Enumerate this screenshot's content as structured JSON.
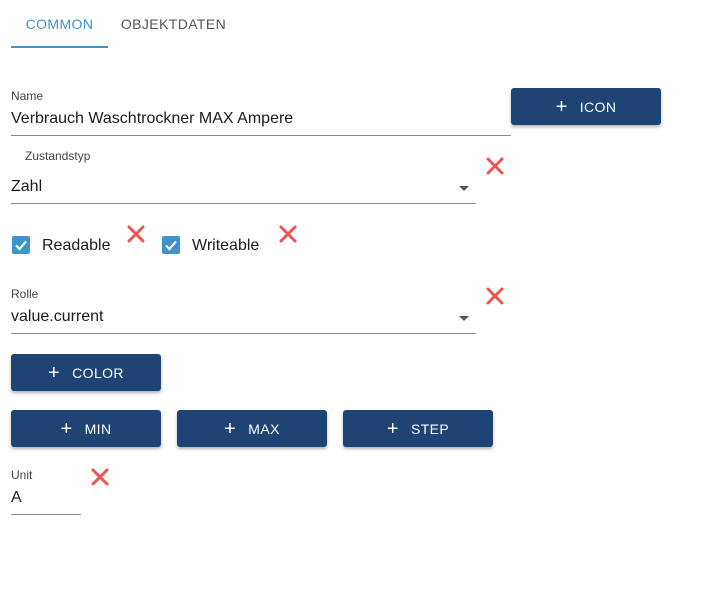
{
  "tabs": [
    {
      "label": "COMMON",
      "active": true
    },
    {
      "label": "OBJEKTDATEN",
      "active": false
    }
  ],
  "name_field": {
    "label": "Name",
    "value": "Verbrauch Waschtrockner MAX Ampere"
  },
  "icon_button": {
    "label": "ICON",
    "icon": "plus-icon"
  },
  "state_type": {
    "label": "Zustandstyp",
    "value": "Zahl"
  },
  "checkboxes": {
    "readable": {
      "label": "Readable",
      "checked": true
    },
    "writeable": {
      "label": "Writeable",
      "checked": true
    }
  },
  "role_field": {
    "label": "Rolle",
    "value": "value.current"
  },
  "color_button": {
    "label": "COLOR",
    "icon": "plus-icon"
  },
  "range_buttons": [
    {
      "label": "MIN",
      "icon": "plus-icon"
    },
    {
      "label": "MAX",
      "icon": "plus-icon"
    },
    {
      "label": "STEP",
      "icon": "plus-icon"
    }
  ],
  "unit_field": {
    "label": "Unit",
    "value": "A"
  },
  "colors": {
    "accent": "#3d94c7",
    "button": "#1d4475",
    "delete": "#ef5350"
  }
}
